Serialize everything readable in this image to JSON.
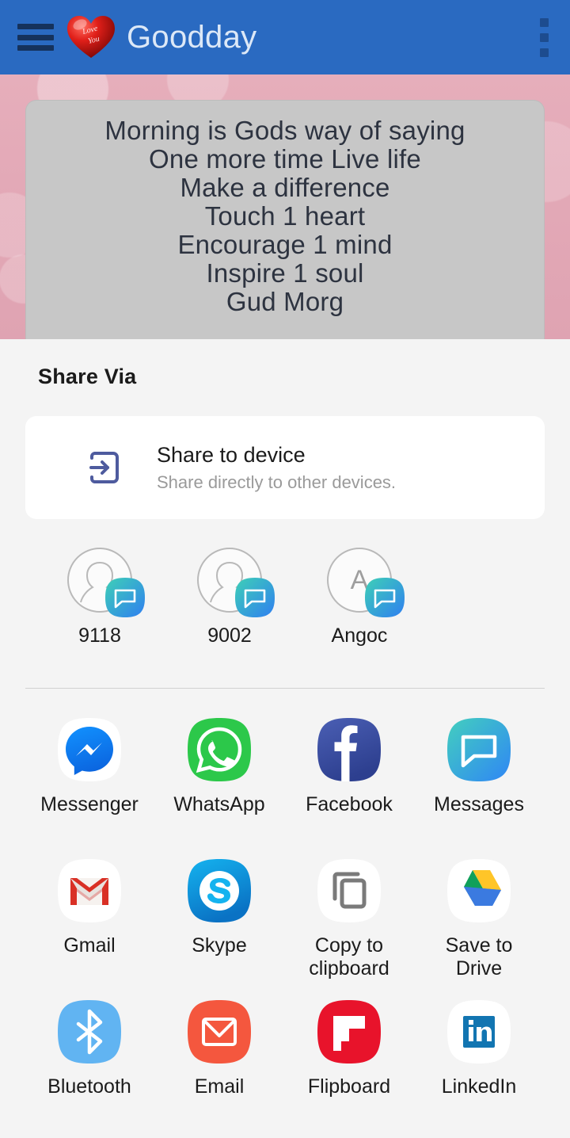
{
  "appbar": {
    "menu_icon": "hamburger-menu-icon",
    "logo_icon": "heart-logo-icon",
    "logo_text": "Love You",
    "title": "Goodday",
    "overflow_icon": "overflow-menu-icon"
  },
  "quote": {
    "lines": [
      "Morning is Gods way of saying",
      "One more time Live life",
      "Make a difference",
      "Touch 1 heart",
      "Encourage 1 mind",
      "Inspire 1 soul",
      "Gud Morg"
    ]
  },
  "share_sheet": {
    "title": "Share Via",
    "device_card": {
      "icon": "share-to-device-icon",
      "title": "Share to device",
      "subtitle": "Share directly to other devices."
    },
    "contacts": [
      {
        "label": "9118",
        "avatar": "person-avatar-icon",
        "badge": "messages-badge-icon"
      },
      {
        "label": "9002",
        "avatar": "person-avatar-icon",
        "badge": "messages-badge-icon"
      },
      {
        "label": "Angoc",
        "avatar": "letter-avatar-icon",
        "initial": "A",
        "badge": "messages-badge-icon"
      }
    ],
    "apps": [
      {
        "label": "Messenger",
        "icon": "messenger-icon"
      },
      {
        "label": "WhatsApp",
        "icon": "whatsapp-icon"
      },
      {
        "label": "Facebook",
        "icon": "facebook-icon"
      },
      {
        "label": "Messages",
        "icon": "messages-icon"
      },
      {
        "label": "Gmail",
        "icon": "gmail-icon"
      },
      {
        "label": "Skype",
        "icon": "skype-icon"
      },
      {
        "label": "Copy to clipboard",
        "icon": "copy-to-clipboard-icon"
      },
      {
        "label": "Save to Drive",
        "icon": "google-drive-icon"
      },
      {
        "label": "Bluetooth",
        "icon": "bluetooth-icon"
      },
      {
        "label": "Email",
        "icon": "email-icon"
      },
      {
        "label": "Flipboard",
        "icon": "flipboard-icon"
      },
      {
        "label": "LinkedIn",
        "icon": "linkedin-icon"
      }
    ]
  },
  "colors": {
    "appbar_blue": "#2a6ac1",
    "wallpaper_pink": "#e3a9b7",
    "quote_card_grey": "#c7c7c7",
    "sheet_background": "#f4f4f4",
    "device_icon_indigo": "#4e5b9e"
  }
}
